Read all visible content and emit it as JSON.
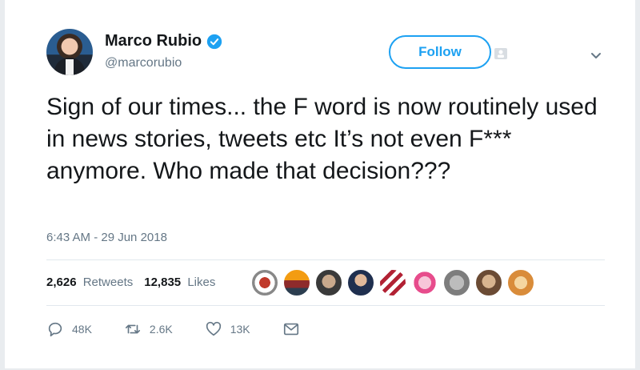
{
  "tweet": {
    "author_name": "Marco Rubio",
    "handle": "@marcorubio",
    "follow_label": "Follow",
    "text": "Sign of our times... the F word is now routinely used in news stories, tweets etc It’s not even F*** anymore.  Who made that decision???",
    "timestamp": "6:43 AM - 29 Jun 2018"
  },
  "stats": {
    "retweets_count": "2,626",
    "retweets_label": "Retweets",
    "likes_count": "12,835",
    "likes_label": "Likes"
  },
  "actions": {
    "reply_count": "48K",
    "retweet_count": "2.6K",
    "like_count": "13K"
  },
  "colors": {
    "accent": "#1da1f2",
    "text_primary": "#14171a",
    "text_secondary": "#657786"
  },
  "icons": [
    "verified-badge-icon",
    "follow-user-icon",
    "chevron-down-icon",
    "reply-icon",
    "retweet-icon",
    "like-icon",
    "direct-message-icon"
  ]
}
